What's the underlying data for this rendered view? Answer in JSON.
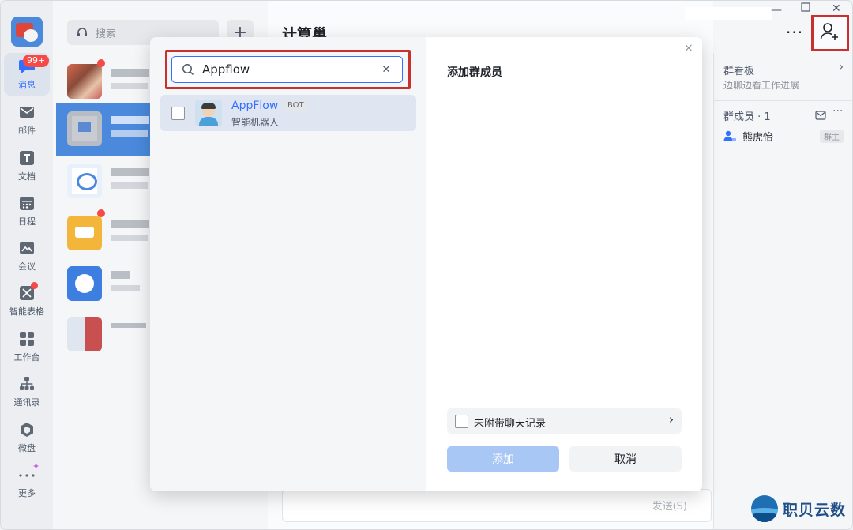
{
  "rail": {
    "items": [
      {
        "label": "消息",
        "badge": "99+"
      },
      {
        "label": "邮件"
      },
      {
        "label": "文档"
      },
      {
        "label": "日程"
      },
      {
        "label": "会议"
      },
      {
        "label": "智能表格"
      },
      {
        "label": "工作台"
      },
      {
        "label": "通讯录"
      },
      {
        "label": "微盘"
      },
      {
        "label": "更多"
      }
    ]
  },
  "chat_list": {
    "search_placeholder": "搜索"
  },
  "chat": {
    "title": "计算巢",
    "more": "···",
    "send_label": "发送(S)"
  },
  "right_panel": {
    "board_title": "群看板",
    "board_sub": "边聊边看工作进展",
    "members_label": "群成员 · 1",
    "more": "···",
    "member_name": "熊虎怡",
    "owner_tag": "群主"
  },
  "modal": {
    "search_value": "Appflow",
    "result": {
      "name": "AppFlow",
      "tag": "BOT",
      "desc": "智能机器人"
    },
    "heading": "添加群成员",
    "attach_label": "未附带聊天记录",
    "add_label": "添加",
    "cancel_label": "取消",
    "close": "×"
  },
  "watermark": {
    "text": "职贝云数"
  },
  "colors": {
    "accent": "#3370ff",
    "highlight": "#c8312d",
    "selected_chat": "#4a89dc"
  }
}
